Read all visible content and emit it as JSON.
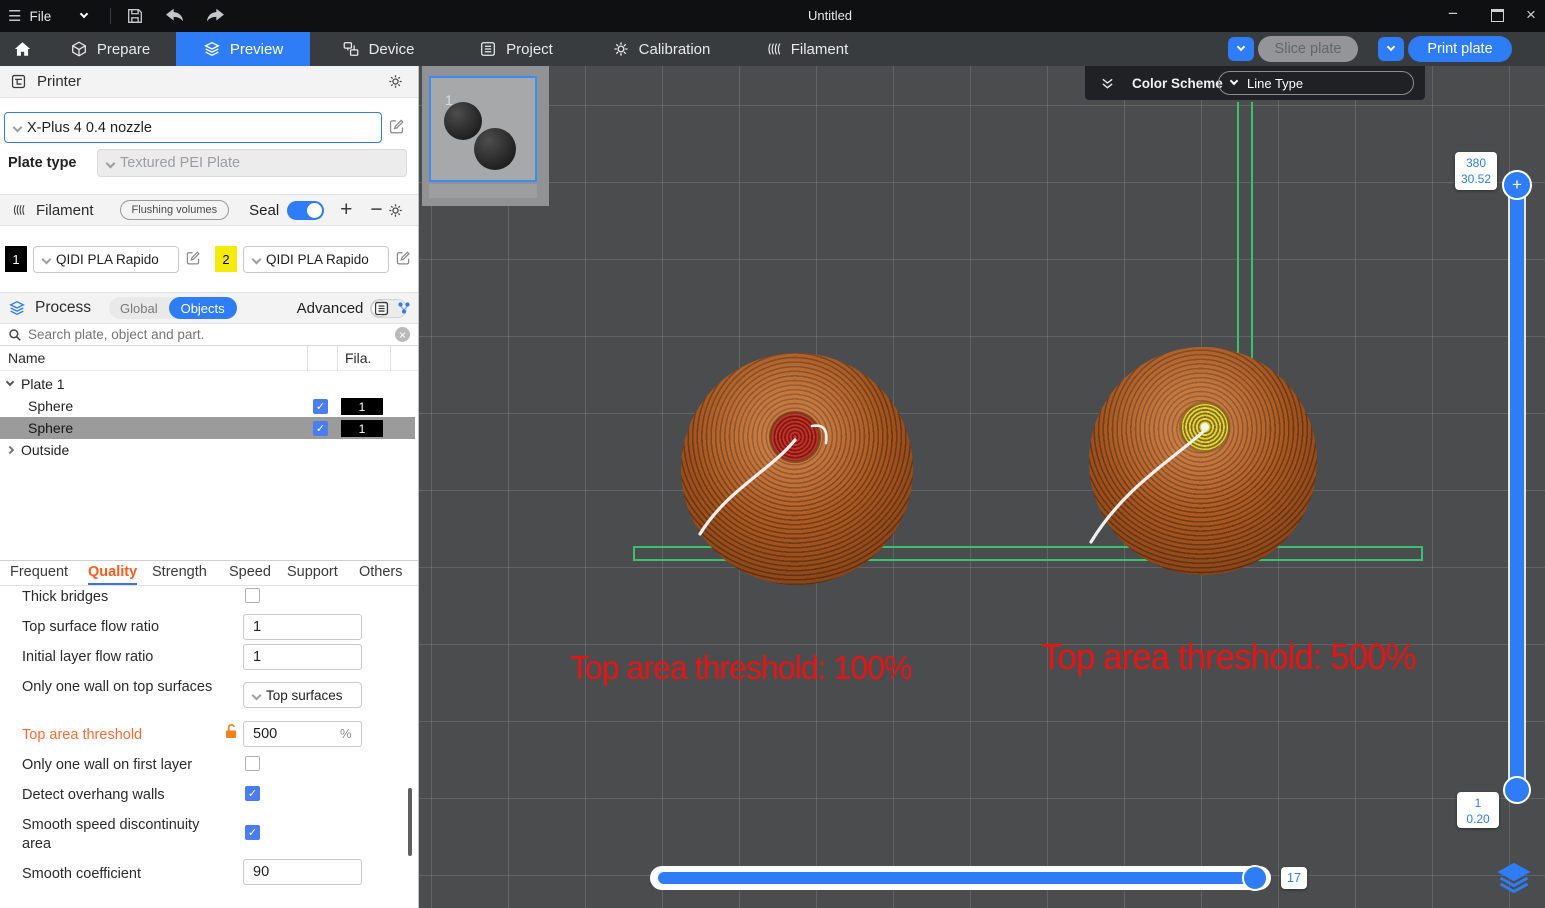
{
  "titlebar": {
    "menu_file": "File",
    "title": "Untitled"
  },
  "tabbar": {
    "prepare": "Prepare",
    "preview": "Preview",
    "device": "Device",
    "project": "Project",
    "calibration": "Calibration",
    "filament": "Filament",
    "slice_plate": "Slice plate",
    "print_plate": "Print plate"
  },
  "printer": {
    "title": "Printer",
    "preset": "X-Plus 4 0.4 nozzle",
    "plate_type_label": "Plate type",
    "plate_type": "Textured PEI Plate"
  },
  "filament": {
    "title": "Filament",
    "flushing": "Flushing volumes",
    "seal": "Seal",
    "slot1": {
      "id": "1",
      "name": "QIDI PLA Rapido",
      "color": "#000000",
      "text_color": "#ffffff"
    },
    "slot2": {
      "id": "2",
      "name": "QIDI PLA Rapido",
      "color": "#f5eb0a",
      "text_color": "#000000"
    }
  },
  "process": {
    "title": "Process",
    "seg_global": "Global",
    "seg_objects": "Objects",
    "advanced": "Advanced",
    "search_placeholder": "Search plate, object and part."
  },
  "tree": {
    "col_name": "Name",
    "col_fila": "Fila.",
    "plate": "Plate 1",
    "sphere1": {
      "name": "Sphere",
      "fila": "1"
    },
    "sphere2": {
      "name": "Sphere",
      "fila": "1"
    },
    "outside": "Outside"
  },
  "param_tabs": {
    "frequent": "Frequent",
    "quality": "Quality",
    "strength": "Strength",
    "speed": "Speed",
    "support": "Support",
    "others": "Others"
  },
  "settings": {
    "thick_bridges": "Thick bridges",
    "top_surface_flow_ratio": {
      "label": "Top surface flow ratio",
      "value": "1"
    },
    "initial_layer_flow_ratio": {
      "label": "Initial layer flow ratio",
      "value": "1"
    },
    "only_one_wall_top": {
      "label": "Only one wall on top surfaces",
      "value": "Top surfaces"
    },
    "top_area_threshold": {
      "label": "Top area threshold",
      "value": "500",
      "unit": "%"
    },
    "only_one_wall_first": "Only one wall on first layer",
    "detect_overhang": "Detect overhang walls",
    "smooth_speed": "Smooth speed discontinuity area",
    "smooth_coefficient": {
      "label": "Smooth coefficient",
      "value": "90"
    }
  },
  "viewport": {
    "thumb_plate_number": "1",
    "color_scheme_label": "Color Scheme",
    "color_scheme_value": "Line Type",
    "annotation_left": "Top area threshold: 100%",
    "annotation_right": "Top area threshold: 500%",
    "layer_slider": {
      "top_value": "380",
      "top_height": "30.52",
      "bottom_value": "1",
      "bottom_height": "0.20"
    },
    "move_slider": {
      "value": "17"
    }
  },
  "icons": {
    "hamburger": "☰",
    "plus": "+",
    "minus": "−",
    "window_minimize": "−",
    "window_close": "×",
    "checkmark": "✓",
    "clear": "×"
  },
  "colors": {
    "accent": "#2e7cf6",
    "orange": "#ff5a1e",
    "green": "#3cc06f",
    "annotation_red": "#e81414"
  }
}
